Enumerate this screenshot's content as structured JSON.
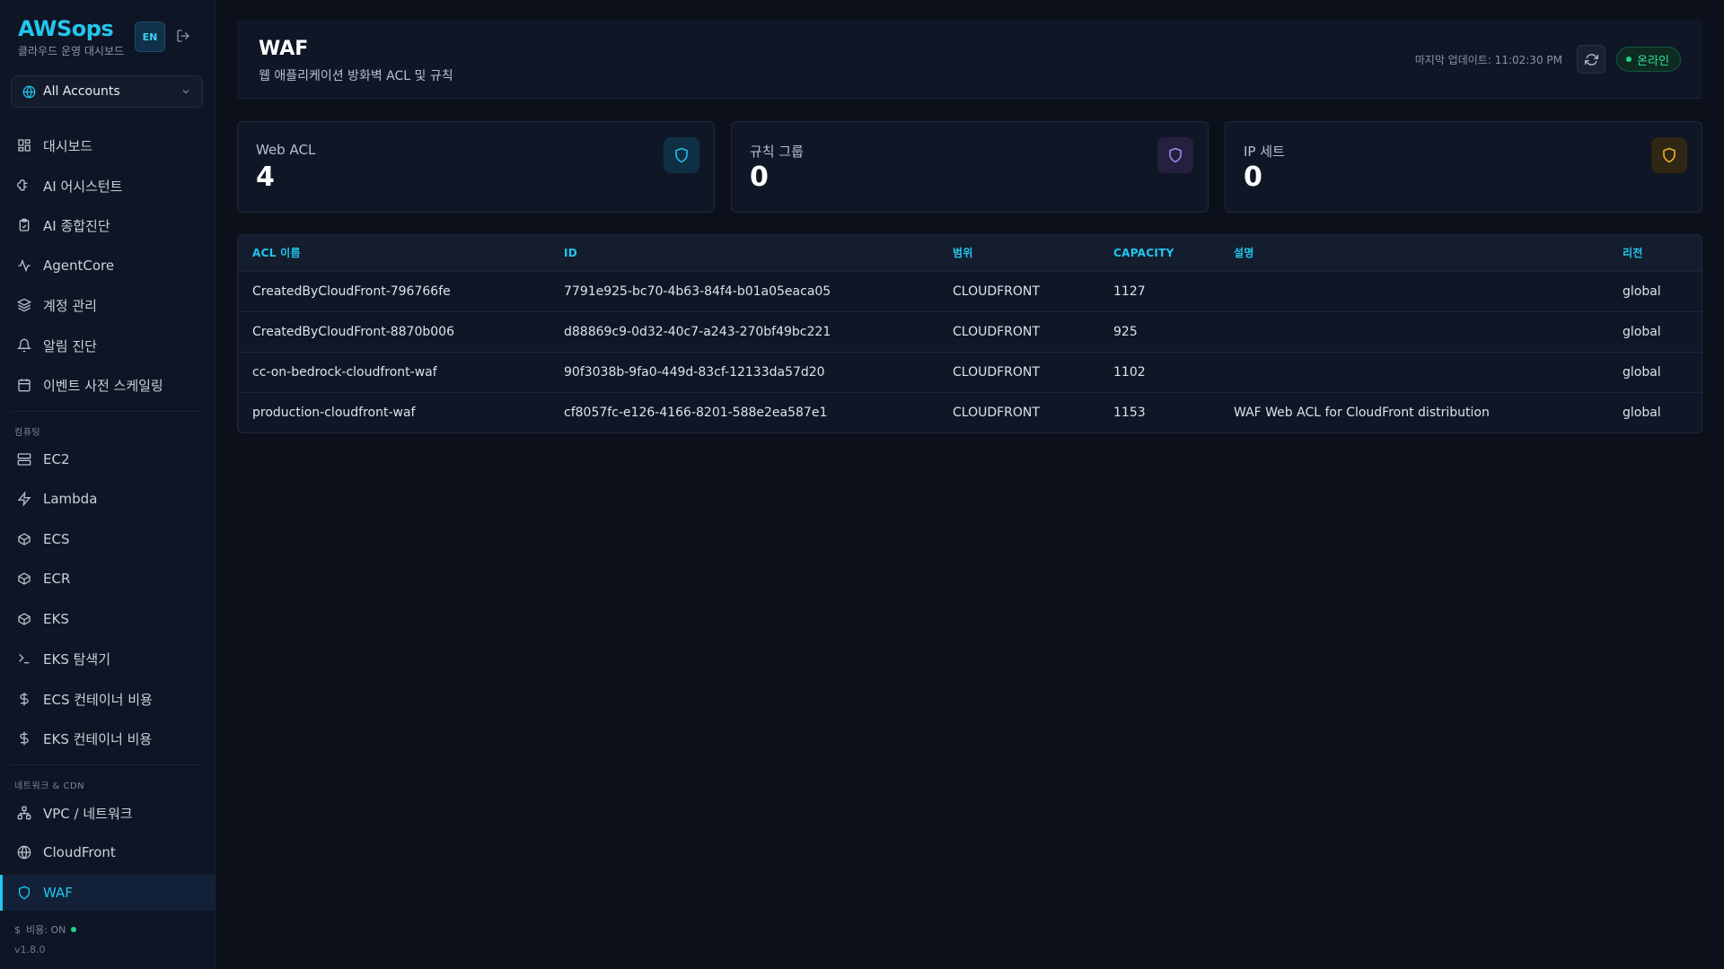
{
  "brand": {
    "title": "AWSops",
    "subtitle": "클라우드 운영 대시보드",
    "lang": "EN"
  },
  "account_selector": {
    "value": "All Accounts"
  },
  "nav": {
    "main": [
      {
        "label": "대시보드",
        "icon": "dashboard-grid-icon"
      },
      {
        "label": "AI 어시스턴트",
        "icon": "brain-icon"
      },
      {
        "label": "AI 종합진단",
        "icon": "clipboard-check-icon"
      },
      {
        "label": "AgentCore",
        "icon": "activity-icon"
      },
      {
        "label": "계정 관리",
        "icon": "layers-icon"
      },
      {
        "label": "알림 진단",
        "icon": "bell-icon"
      },
      {
        "label": "이벤트 사전 스케일링",
        "icon": "calendar-icon"
      }
    ],
    "compute_label": "컴퓨팅",
    "compute": [
      {
        "label": "EC2",
        "icon": "server-icon"
      },
      {
        "label": "Lambda",
        "icon": "lightning-icon"
      },
      {
        "label": "ECS",
        "icon": "box-icon"
      },
      {
        "label": "ECR",
        "icon": "box-icon"
      },
      {
        "label": "EKS",
        "icon": "box-icon"
      },
      {
        "label": "EKS 탐색기",
        "icon": "terminal-icon"
      },
      {
        "label": "ECS 컨테이너 비용",
        "icon": "dollar-icon"
      },
      {
        "label": "EKS 컨테이너 비용",
        "icon": "dollar-icon"
      }
    ],
    "network_label": "네트워크 & CDN",
    "network": [
      {
        "label": "VPC / 네트워크",
        "icon": "network-icon"
      },
      {
        "label": "CloudFront",
        "icon": "globe-icon"
      },
      {
        "label": "WAF",
        "icon": "shield-icon",
        "active": true
      }
    ]
  },
  "footer": {
    "cost": "비용: ON",
    "version": "v1.8.0"
  },
  "header": {
    "title": "WAF",
    "subtitle": "웹 애플리케이션 방화벽 ACL 및 규칙",
    "last_updated": "마지막 업데이트: 11:02:30 PM",
    "status": "온라인"
  },
  "stats": [
    {
      "label": "Web ACL",
      "value": "4",
      "color": "#22c6ee",
      "bg": "#0f2f44"
    },
    {
      "label": "규칙 그룹",
      "value": "0",
      "color": "#a78bfa",
      "bg": "#26203f"
    },
    {
      "label": "IP 세트",
      "value": "0",
      "color": "#f5b82e",
      "bg": "#302614"
    }
  ],
  "table": {
    "columns": [
      "ACL 이름",
      "ID",
      "범위",
      "CAPACITY",
      "설명",
      "리전"
    ],
    "rows": [
      [
        "CreatedByCloudFront-796766fe",
        "7791e925-bc70-4b63-84f4-b01a05eaca05",
        "CLOUDFRONT",
        "1127",
        "",
        "global"
      ],
      [
        "CreatedByCloudFront-8870b006",
        "d88869c9-0d32-40c7-a243-270bf49bc221",
        "CLOUDFRONT",
        "925",
        "",
        "global"
      ],
      [
        "cc-on-bedrock-cloudfront-waf",
        "90f3038b-9fa0-449d-83cf-12133da57d20",
        "CLOUDFRONT",
        "1102",
        "",
        "global"
      ],
      [
        "production-cloudfront-waf",
        "cf8057fc-e126-4166-8201-588e2ea587e1",
        "CLOUDFRONT",
        "1153",
        "WAF Web ACL for CloudFront distribution",
        "global"
      ]
    ]
  }
}
